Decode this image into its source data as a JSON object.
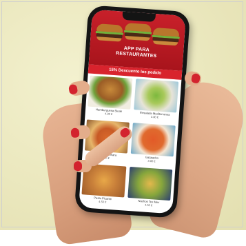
{
  "app": {
    "banner_title_line1": "APP PARA",
    "banner_title_line2": "RESTAURANTES",
    "promo_text": "15% Descuento los pedido",
    "menu_items": [
      {
        "name": "Hamburguesa Steak",
        "price": "4.80 €"
      },
      {
        "name": "Ensalada Mediterranea",
        "price": "3.80 €"
      },
      {
        "name": "Pizza Carbonara",
        "price": "4.90 €"
      },
      {
        "name": "Gazpacho",
        "price": "3.80 €"
      },
      {
        "name": "Pasta Picante",
        "price": "4.50 €"
      },
      {
        "name": "Nachos Tex Mex",
        "price": "4.50 €"
      }
    ]
  },
  "colors": {
    "brand_red": "#c8202a",
    "nail_red": "#d3232e",
    "background": "#ece9c0"
  }
}
